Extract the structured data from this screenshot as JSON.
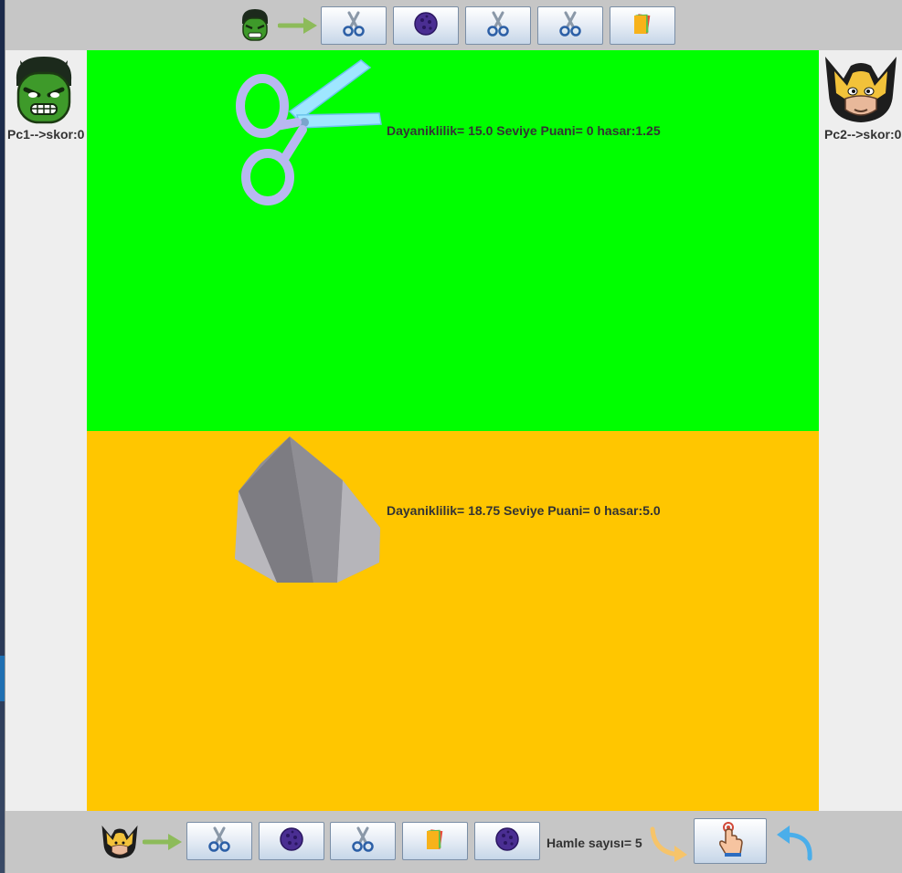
{
  "players": {
    "pc1": {
      "score_label": "Pc1-->skor:0",
      "avatar": "hulk-icon"
    },
    "pc2": {
      "score_label": "Pc2-->skor:0",
      "avatar": "wolverine-icon"
    }
  },
  "top_toolbar": {
    "items": [
      {
        "icon": "scissors-icon"
      },
      {
        "icon": "rock-icon"
      },
      {
        "icon": "scissors-icon"
      },
      {
        "icon": "scissors-icon"
      },
      {
        "icon": "paper-icon"
      }
    ]
  },
  "bottom_toolbar": {
    "items": [
      {
        "icon": "scissors-icon"
      },
      {
        "icon": "rock-icon"
      },
      {
        "icon": "scissors-icon"
      },
      {
        "icon": "paper-icon"
      },
      {
        "icon": "rock-icon"
      }
    ],
    "move_count_label": "Hamle sayısı= 5"
  },
  "arena": {
    "p1": {
      "object_icon": "scissors-icon",
      "stats": "Dayaniklilik= 15.0 Seviye Puani= 0 hasar:1.25",
      "color": "#00ff00"
    },
    "p2": {
      "object_icon": "rock-icon",
      "stats": "Dayaniklilik= 18.75 Seviye Puani= 0 hasar:5.0",
      "color": "#ffc600"
    }
  }
}
